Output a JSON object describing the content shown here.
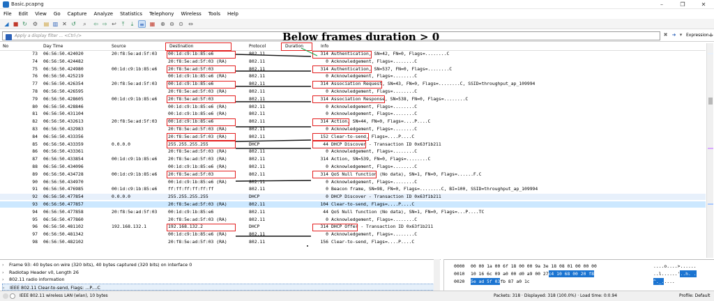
{
  "window": {
    "title": "Basic.pcapng",
    "icon": "wireshark-fin-icon"
  },
  "menu": [
    "File",
    "Edit",
    "View",
    "Go",
    "Capture",
    "Analyze",
    "Statistics",
    "Telephony",
    "Wireless",
    "Tools",
    "Help"
  ],
  "toolbar_icons": [
    "shark-fin-start-icon",
    "stop-square-icon",
    "restart-icon",
    "settings-gear-icon",
    "open-folder-icon",
    "save-file-icon",
    "close-file-icon",
    "reload-icon",
    "find-icon",
    "go-back-icon",
    "go-forward-icon",
    "go-to-packet-icon",
    "go-first-icon",
    "go-last-icon",
    "autoscroll-icon",
    "colorize-icon",
    "zoom-in-icon",
    "zoom-out-icon",
    "normal-size-icon",
    "resize-columns-icon"
  ],
  "filter": {
    "placeholder": "Apply a display filter ... <Ctrl-/>",
    "expression_label": "Expression...",
    "plus_label": "+"
  },
  "annotation": {
    "title": "Below frames duration > 0"
  },
  "columns": {
    "no": "No",
    "time": "Day Time",
    "source": "Source",
    "destination": "Destination",
    "protocol": "Protocol",
    "duration": "Duration",
    "info": "Info"
  },
  "packets": [
    {
      "no": "73",
      "time": "06:56:50.424020",
      "src": "20:f8:5e:ad:5f:03",
      "dst": "00:1d:c9:1b:85:e6",
      "proto": "802.11",
      "dur": "314",
      "info": "Authentication, SN=42, FN=0, Flags=........C"
    },
    {
      "no": "74",
      "time": "06:56:50.424482",
      "src": "",
      "dst": "20:f8:5e:ad:5f:03 (RA)",
      "proto": "802.11",
      "dur": "0",
      "info": "Acknowledgement, Flags=........C"
    },
    {
      "no": "75",
      "time": "06:56:50.424980",
      "src": "00:1d:c9:1b:85:e6",
      "dst": "20:f8:5e:ad:5f:03",
      "proto": "802.11",
      "dur": "314",
      "info": "Authentication, SN=537, FN=0, Flags=........C"
    },
    {
      "no": "76",
      "time": "06:56:50.425219",
      "src": "",
      "dst": "00:1d:c9:1b:85:e6 (RA)",
      "proto": "802.11",
      "dur": "0",
      "info": "Acknowledgement, Flags=........C"
    },
    {
      "no": "77",
      "time": "06:56:50.426354",
      "src": "20:f8:5e:ad:5f:03",
      "dst": "00:1d:c9:1b:85:e6",
      "proto": "802.11",
      "dur": "314",
      "info": "Association Request, SN=43, FN=0, Flags=........C, SSID=throughput_ap_109994"
    },
    {
      "no": "78",
      "time": "06:56:50.426595",
      "src": "",
      "dst": "20:f8:5e:ad:5f:03 (RA)",
      "proto": "802.11",
      "dur": "0",
      "info": "Acknowledgement, Flags=........C"
    },
    {
      "no": "79",
      "time": "06:56:50.428605",
      "src": "00:1d:c9:1b:85:e6",
      "dst": "20:f8:5e:ad:5f:03",
      "proto": "802.11",
      "dur": "314",
      "info": "Association Response, SN=538, FN=0, Flags=........C"
    },
    {
      "no": "80",
      "time": "06:56:50.428846",
      "src": "",
      "dst": "00:1d:c9:1b:85:e6 (RA)",
      "proto": "802.11",
      "dur": "0",
      "info": "Acknowledgement, Flags=........C"
    },
    {
      "no": "81",
      "time": "06:56:50.431104",
      "src": "",
      "dst": "00:1d:c9:1b:85:e6 (RA)",
      "proto": "802.11",
      "dur": "0",
      "info": "Acknowledgement, Flags=........C"
    },
    {
      "no": "82",
      "time": "06:56:50.432613",
      "src": "20:f8:5e:ad:5f:03",
      "dst": "00:1d:c9:1b:85:e6",
      "proto": "802.11",
      "dur": "314",
      "info": "Action, SN=44, FN=0, Flags=....P....C"
    },
    {
      "no": "83",
      "time": "06:56:50.432983",
      "src": "",
      "dst": "20:f8:5e:ad:5f:03 (RA)",
      "proto": "802.11",
      "dur": "0",
      "info": "Acknowledgement, Flags=........C"
    },
    {
      "no": "84",
      "time": "06:56:50.433356",
      "src": "",
      "dst": "20:f8:5e:ad:5f:03 (RA)",
      "proto": "802.11",
      "dur": "152",
      "info": "Clear-to-send, Flags=....P....C"
    },
    {
      "no": "85",
      "time": "06:56:50.433359",
      "src": "0.0.0.0",
      "dst": "255.255.255.255",
      "proto": "DHCP",
      "dur": "44",
      "info": "DHCP Discover - Transaction ID 0x63f1b211"
    },
    {
      "no": "86",
      "time": "06:56:50.433361",
      "src": "",
      "dst": "20:f8:5e:ad:5f:03 (RA)",
      "proto": "802.11",
      "dur": "0",
      "info": "Acknowledgement, Flags=........C"
    },
    {
      "no": "87",
      "time": "06:56:50.433854",
      "src": "00:1d:c9:1b:85:e6",
      "dst": "20:f8:5e:ad:5f:03 (RA)",
      "proto": "802.11",
      "dur": "314",
      "info": "Action, SN=539, FN=0, Flags=........C"
    },
    {
      "no": "88",
      "time": "06:56:50.434096",
      "src": "",
      "dst": "00:1d:c9:1b:85:e6 (RA)",
      "proto": "802.11",
      "dur": "0",
      "info": "Acknowledgement, Flags=........C"
    },
    {
      "no": "89",
      "time": "06:56:50.434728",
      "src": "00:1d:c9:1b:85:e6",
      "dst": "20:f8:5e:ad:5f:03",
      "proto": "802.11",
      "dur": "314",
      "info": "QoS Null function (No data), SN=1, FN=0, Flags=......F.C"
    },
    {
      "no": "90",
      "time": "06:56:50.434970",
      "src": "",
      "dst": "00:1d:c9:1b:85:e6 (RA)",
      "proto": "802.11",
      "dur": "0",
      "info": "Acknowledgement, Flags=........C"
    },
    {
      "no": "91",
      "time": "06:56:50.476985",
      "src": "00:1d:c9:1b:85:e6",
      "dst": "ff:ff:ff:ff:ff:ff",
      "proto": "802.11",
      "dur": "0",
      "info": "Beacon frame, SN=98, FN=0, Flags=........C, BI=100, SSID=throughput_ap_109994"
    },
    {
      "no": "92",
      "time": "06:56:50.477854",
      "src": "0.0.0.0",
      "dst": "255.255.255.255",
      "proto": "DHCP",
      "dur": "0",
      "info": "DHCP Discover - Transaction ID 0x63f1b211"
    },
    {
      "no": "93",
      "time": "06:56:50.477857",
      "src": "",
      "dst": "20:f8:5e:ad:5f:03 (RA)",
      "proto": "802.11",
      "dur": "104",
      "info": "Clear-to-send, Flags=....P....C"
    },
    {
      "no": "94",
      "time": "06:56:50.477858",
      "src": "20:f8:5e:ad:5f:03",
      "dst": "00:1d:c9:1b:85:e6",
      "proto": "802.11",
      "dur": "44",
      "info": "QoS Null function (No data), SN=1, FN=0, Flags=...P....TC"
    },
    {
      "no": "95",
      "time": "06:56:50.477860",
      "src": "",
      "dst": "20:f8:5e:ad:5f:03 (RA)",
      "proto": "802.11",
      "dur": "0",
      "info": "Acknowledgement, Flags=........C"
    },
    {
      "no": "96",
      "time": "06:56:50.481102",
      "src": "192.168.132.1",
      "dst": "192.168.132.2",
      "proto": "DHCP",
      "dur": "314",
      "info": "DHCP Offer - Transaction ID 0x63f1b211"
    },
    {
      "no": "97",
      "time": "06:56:50.481342",
      "src": "",
      "dst": "00:1d:c9:1b:85:e6 (RA)",
      "proto": "802.11",
      "dur": "0",
      "info": "Acknowledgement, Flags=........C"
    },
    {
      "no": "98",
      "time": "06:56:50.482102",
      "src": "",
      "dst": "20:f8:5e:ad:5f:03 (RA)",
      "proto": "802.11",
      "dur": "156",
      "info": "Clear-to-send, Flags=....P....C"
    }
  ],
  "details": [
    "Frame 93: 40 bytes on wire (320 bits), 40 bytes captured (320 bits) on interface 0",
    "Radiotap Header v0, Length 26",
    "802.11 radio information",
    "IEEE 802.11 Clear-to-send, Flags: ...P....C"
  ],
  "hex": [
    {
      "off": "0000",
      "bytes": "00 00 1a 00 6f 18 00 00  9a 3e 18 08 01 00 00 00",
      "hl": "",
      "ascii": "....o....>......",
      "ahl": ""
    },
    {
      "off": "0010",
      "bytes": "10 16 6c 09 a0 00 d0 a9  00 27 ",
      "hl": "c4 10 68 00 20 f8",
      "ascii": "..l......'",
      "ahl": "..h. ."
    },
    {
      "off": "0020",
      "bytes": "",
      "hl": "5e ad 5f 03",
      "tail": " fb 87 a0 1c",
      "ascii": "",
      "ahl": "^._.",
      "atail": "...."
    }
  ],
  "status": {
    "interface": "IEEE 802.11 wireless LAN (wlan), 10 bytes",
    "packets": "Packets: 318 · Displayed: 318 (100.0%) · Load time: 0:0.94",
    "profile": "Profile: Default"
  },
  "colors": {
    "selected_row": "#cce8ff",
    "annotation": "#e41e1e",
    "hex_highlight": "#1b74d1"
  }
}
